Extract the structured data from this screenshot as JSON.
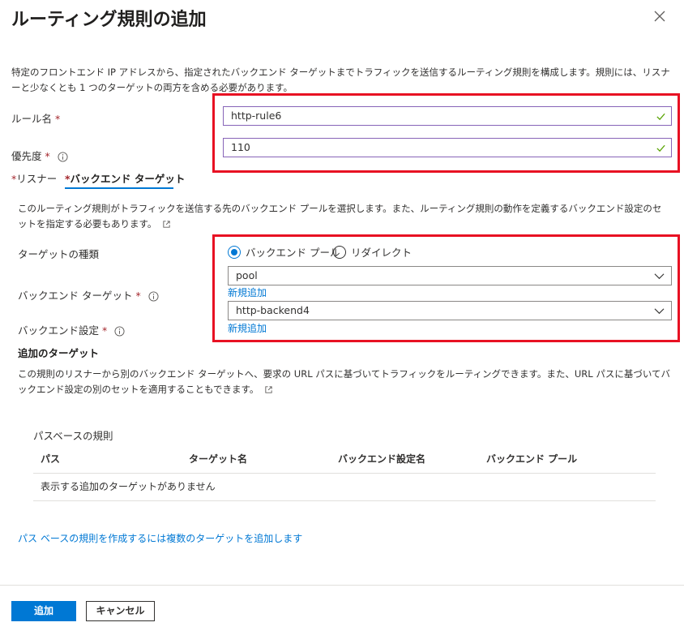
{
  "panel": {
    "title": "ルーティング規則の追加",
    "description": "特定のフロントエンド IP アドレスから、指定されたバックエンド ターゲットまでトラフィックを送信するルーティング規則を構成します。規則には、リスナーと少なくとも 1 つのターゲットの両方を含める必要があります。"
  },
  "form": {
    "rule_name_label": "ルール名",
    "rule_name_value": "http-rule6",
    "priority_label": "優先度",
    "priority_value": "110",
    "required_mark": "*"
  },
  "tabs": [
    {
      "label": "リスナー",
      "active": false
    },
    {
      "label": "バックエンド ターゲット",
      "active": true
    }
  ],
  "backend": {
    "description": "このルーティング規則がトラフィックを送信する先のバックエンド プールを選択します。また、ルーティング規則の動作を定義するバックエンド設定のセットを指定する必要もあります。",
    "target_type_label": "ターゲットの種類",
    "target_type_options": [
      "バックエンド プール",
      "リダイレクト"
    ],
    "target_type_selected": "バックエンド プール",
    "backend_target_label": "バックエンド ターゲット",
    "backend_target_value": "pool",
    "backend_settings_label": "バックエンド設定",
    "backend_settings_value": "http-backend4",
    "add_new_label": "新規追加"
  },
  "additional": {
    "heading": "追加のターゲット",
    "description": "この規則のリスナーから別のバックエンド ターゲットへ、要求の URL パスに基づいてトラフィックをルーティングできます。また、URL パスに基づいてバックエンド設定の別のセットを適用することもできます。",
    "path_rules_title": "パスベースの規則",
    "columns": [
      "パス",
      "ターゲット名",
      "バックエンド設定名",
      "バックエンド プール"
    ],
    "empty_message": "表示する追加のターゲットがありません",
    "add_link": "パス ベースの規則を作成するには複数のターゲットを追加します"
  },
  "footer": {
    "add_button": "追加",
    "cancel_button": "キャンセル"
  },
  "colors": {
    "accent": "#0078d4",
    "highlight_box": "#e81123",
    "valid_check": "#57a300"
  }
}
